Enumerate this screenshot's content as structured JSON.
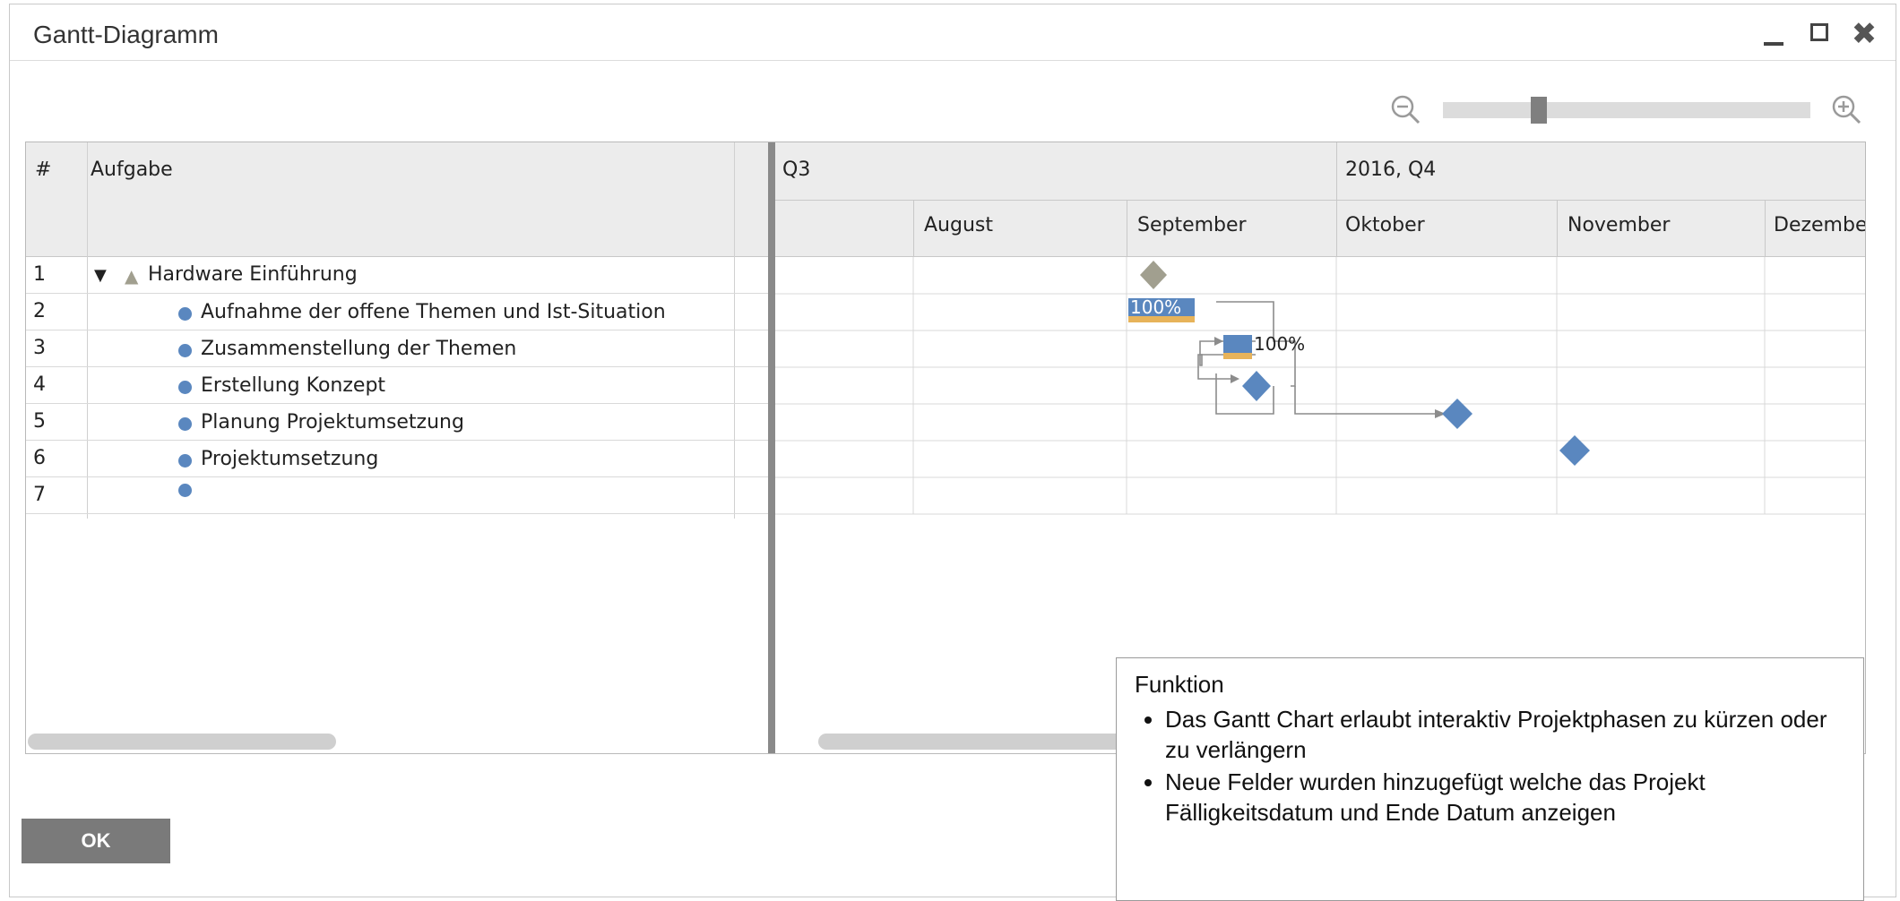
{
  "window": {
    "title": "Gantt-Diagramm"
  },
  "grid": {
    "col_num_header": "#",
    "col_task_header": "Aufgabe",
    "quarters": [
      "Q3",
      "2016, Q4"
    ],
    "months": [
      "August",
      "September",
      "Oktober",
      "November",
      "Dezember"
    ],
    "rows": [
      {
        "num": "1",
        "task": "Hardware Einführung"
      },
      {
        "num": "2",
        "task": "Aufnahme der offene Themen und Ist-Situation"
      },
      {
        "num": "3",
        "task": "Zusammenstellung der Themen"
      },
      {
        "num": "4",
        "task": "Erstellung Konzept"
      },
      {
        "num": "5",
        "task": "Planung Projektumsetzung"
      },
      {
        "num": "6",
        "task": "Projektumsetzung"
      },
      {
        "num": "7",
        "task": ""
      }
    ],
    "progress_labels": [
      "100%",
      "100%"
    ]
  },
  "buttons": {
    "ok": "OK"
  },
  "callout": {
    "heading": "Funktion",
    "bullets": [
      "Das Gantt Chart erlaubt interaktiv Projektphasen zu kürzen oder zu verlängern",
      "Neue Felder wurden hinzugefügt welche das Projekt Fälligkeitsdatum und Ende Datum anzeigen"
    ]
  },
  "colors": {
    "task_blue": "#5a87bf",
    "summary_gray": "#a19f8f",
    "progress_orange": "#e7b35a"
  }
}
